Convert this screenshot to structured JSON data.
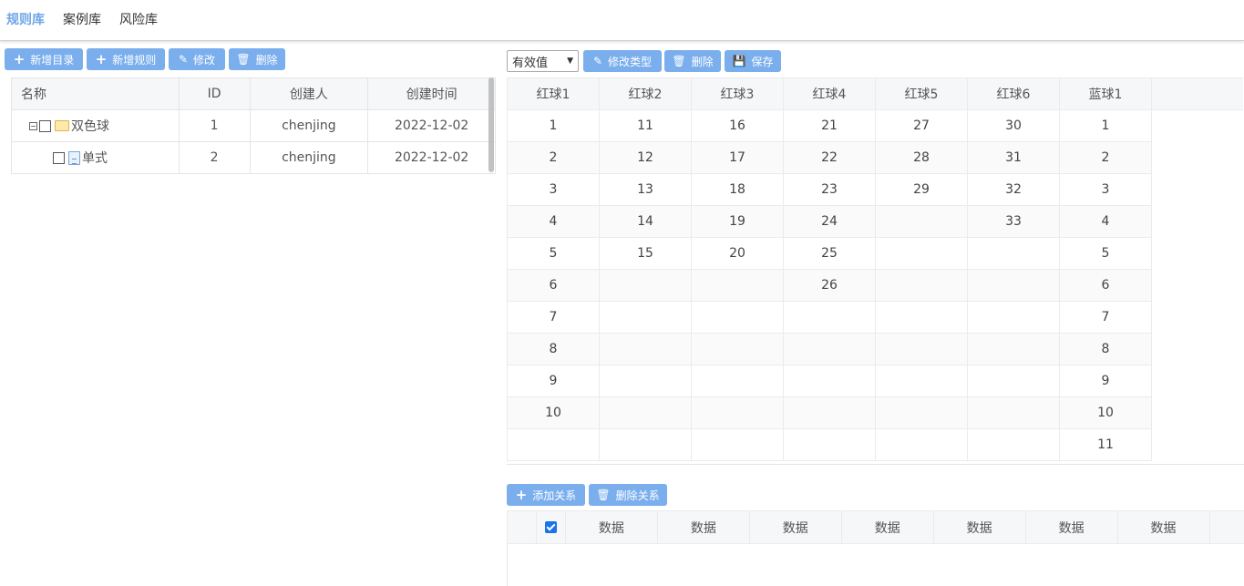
{
  "nav": {
    "tabs": [
      "规则库",
      "案例库",
      "风险库"
    ]
  },
  "left": {
    "toolbar": {
      "add_dir": "新增目录",
      "add_rule": "新增规则",
      "edit": "修改",
      "delete": "删除"
    },
    "columns": [
      "名称",
      "ID",
      "创建人",
      "创建时间"
    ],
    "rows": [
      {
        "name": "双色球",
        "id": "1",
        "creator": "chenjing",
        "created": "2022-12-02"
      },
      {
        "name": "单式",
        "id": "2",
        "creator": "chenjing",
        "created": "2022-12-02"
      }
    ]
  },
  "right": {
    "select_value": "有效值",
    "toolbar": {
      "edit_type": "修改类型",
      "delete": "删除",
      "save": "保存"
    },
    "columns": [
      "红球1",
      "红球2",
      "红球3",
      "红球4",
      "红球5",
      "红球6",
      "蓝球1"
    ],
    "rows": [
      [
        "1",
        "11",
        "16",
        "21",
        "27",
        "30",
        "1"
      ],
      [
        "2",
        "12",
        "17",
        "22",
        "28",
        "31",
        "2"
      ],
      [
        "3",
        "13",
        "18",
        "23",
        "29",
        "32",
        "3"
      ],
      [
        "4",
        "14",
        "19",
        "24",
        "",
        "33",
        "4"
      ],
      [
        "5",
        "15",
        "20",
        "25",
        "",
        "",
        "5"
      ],
      [
        "6",
        "",
        "",
        "26",
        "",
        "",
        "6"
      ],
      [
        "7",
        "",
        "",
        "",
        "",
        "",
        "7"
      ],
      [
        "8",
        "",
        "",
        "",
        "",
        "",
        "8"
      ],
      [
        "9",
        "",
        "",
        "",
        "",
        "",
        "9"
      ],
      [
        "10",
        "",
        "",
        "",
        "",
        "",
        "10"
      ],
      [
        "",
        "",
        "",
        "",
        "",
        "",
        "11"
      ]
    ]
  },
  "relations": {
    "toolbar": {
      "add": "添加关系",
      "delete": "删除关系"
    },
    "columns": [
      "数据",
      "数据",
      "数据",
      "数据",
      "数据",
      "数据",
      "数据"
    ]
  },
  "colors": {
    "accent": "#7aaeed",
    "active_tab": "#6fa6e8"
  }
}
